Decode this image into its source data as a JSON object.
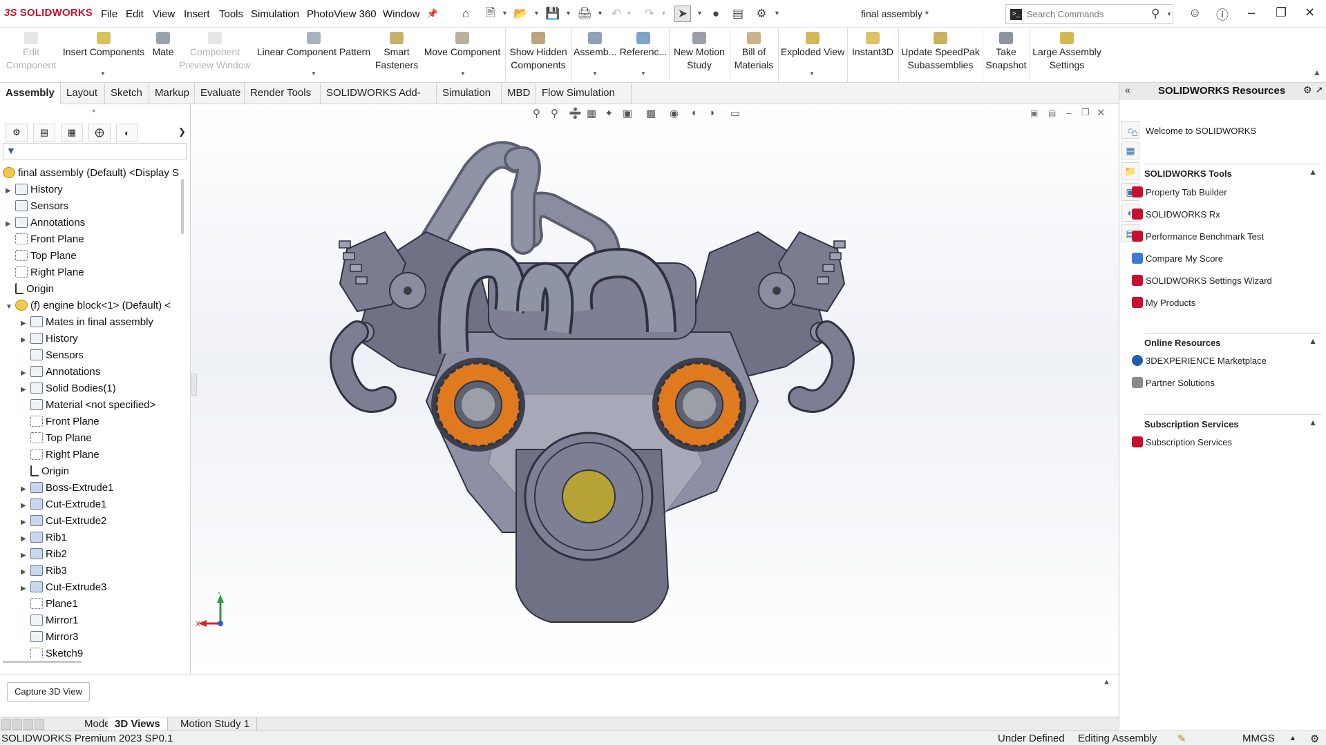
{
  "app": {
    "name": "SOLIDWORKS",
    "logo_prefix": "3S",
    "document_title": "final assembly *"
  },
  "menu": [
    "File",
    "Edit",
    "View",
    "Insert",
    "Tools",
    "Simulation",
    "PhotoView 360",
    "Window"
  ],
  "search": {
    "placeholder": "Search Commands"
  },
  "ribbon": {
    "buttons": [
      {
        "label1": "Edit",
        "label2": "Component",
        "disabled": true
      },
      {
        "label1": "Insert Components",
        "label2": "",
        "disabled": false
      },
      {
        "label1": "Mate",
        "label2": "",
        "disabled": false
      },
      {
        "label1": "Component",
        "label2": "Preview Window",
        "disabled": true
      },
      {
        "label1": "Linear Component Pattern",
        "label2": "",
        "disabled": false
      },
      {
        "label1": "Smart",
        "label2": "Fasteners",
        "disabled": false
      },
      {
        "label1": "Move Component",
        "label2": "",
        "disabled": false
      },
      {
        "label1": "Show Hidden",
        "label2": "Components",
        "disabled": false
      },
      {
        "label1": "Assemb...",
        "label2": "",
        "disabled": false
      },
      {
        "label1": "Referenc...",
        "label2": "",
        "disabled": false
      },
      {
        "label1": "New Motion",
        "label2": "Study",
        "disabled": false
      },
      {
        "label1": "Bill of",
        "label2": "Materials",
        "disabled": false
      },
      {
        "label1": "Exploded View",
        "label2": "",
        "disabled": false
      },
      {
        "label1": "Instant3D",
        "label2": "",
        "disabled": false
      },
      {
        "label1": "Update SpeedPak",
        "label2": "Subassemblies",
        "disabled": false
      },
      {
        "label1": "Take",
        "label2": "Snapshot",
        "disabled": false
      },
      {
        "label1": "Large Assembly",
        "label2": "Settings",
        "disabled": false
      }
    ]
  },
  "tabs": [
    "Assembly",
    "Layout",
    "Sketch",
    "Markup",
    "Evaluate",
    "Render Tools",
    "SOLIDWORKS Add-Ins",
    "Simulation",
    "MBD",
    "Flow Simulation"
  ],
  "tree": {
    "root": "final assembly (Default) <Display S",
    "items": [
      "History",
      "Sensors",
      "Annotations",
      "Front Plane",
      "Top Plane",
      "Right Plane",
      "Origin",
      "(f) engine block<1> (Default) <",
      "Mates in final assembly",
      "History",
      "Sensors",
      "Annotations",
      "Solid Bodies(1)",
      "Material <not specified>",
      "Front Plane",
      "Top Plane",
      "Right Plane",
      "Origin",
      "Boss-Extrude1",
      "Cut-Extrude1",
      "Cut-Extrude2",
      "Rib1",
      "Rib2",
      "Rib3",
      "Cut-Extrude3",
      "Plane1",
      "Mirror1",
      "Mirror3",
      "Sketch9"
    ]
  },
  "triad": {
    "x": "X",
    "y": "Y"
  },
  "taskpane": {
    "title": "SOLIDWORKS Resources",
    "welcome": "Welcome to SOLIDWORKS",
    "sections": [
      {
        "title": "SOLIDWORKS Tools",
        "items": [
          "Property Tab Builder",
          "SOLIDWORKS Rx",
          "Performance Benchmark Test",
          "Compare My Score",
          "SOLIDWORKS Settings Wizard",
          "My Products"
        ]
      },
      {
        "title": "Online Resources",
        "items": [
          "3DEXPERIENCE Marketplace",
          "Partner Solutions"
        ]
      },
      {
        "title": "Subscription Services",
        "items": [
          "Subscription Services"
        ]
      }
    ]
  },
  "bottom": {
    "capture_button": "Capture 3D View",
    "tabs": [
      "Model",
      "3D Views",
      "Motion Study 1"
    ],
    "active_tab": "3D Views"
  },
  "status": {
    "product": "SOLIDWORKS Premium 2023 SP0.1",
    "state": "Under Defined",
    "mode": "Editing Assembly",
    "units": "MMGS"
  },
  "colors": {
    "brand": "#c8102e",
    "model_body": "#6f7285",
    "rotor": "#e07a1f",
    "pulley": "#b7a235"
  }
}
